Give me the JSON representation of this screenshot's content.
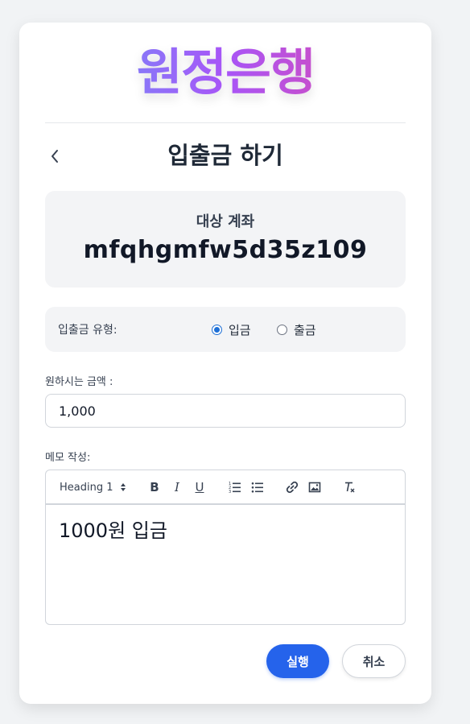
{
  "brand": {
    "logo_text": "원정은행"
  },
  "header": {
    "title": "입출금 하기",
    "back_icon": "chevron-left-icon"
  },
  "account": {
    "label": "대상 계좌",
    "number": "mfqhgmfw5d35z109"
  },
  "transaction_type": {
    "label": "입출금 유형:",
    "options": [
      {
        "label": "입금",
        "selected": true
      },
      {
        "label": "출금",
        "selected": false
      }
    ]
  },
  "amount": {
    "label": "원하시는 금액 :",
    "value": "1,000"
  },
  "memo": {
    "label": "메모 작성:",
    "toolbar": {
      "heading_select": "Heading 1",
      "bold": "B",
      "italic": "I",
      "underline": "U",
      "icons": [
        "ordered-list-icon",
        "bullet-list-icon",
        "link-icon",
        "image-icon",
        "clear-format-icon"
      ]
    },
    "content": "1000원 입금"
  },
  "actions": {
    "submit": "실행",
    "cancel": "취소"
  },
  "colors": {
    "primary": "#2563eb",
    "logo_gradient": [
      "#60a5fa",
      "#a855f7",
      "#ec4899"
    ],
    "panel_bg": "#f3f4f6"
  }
}
